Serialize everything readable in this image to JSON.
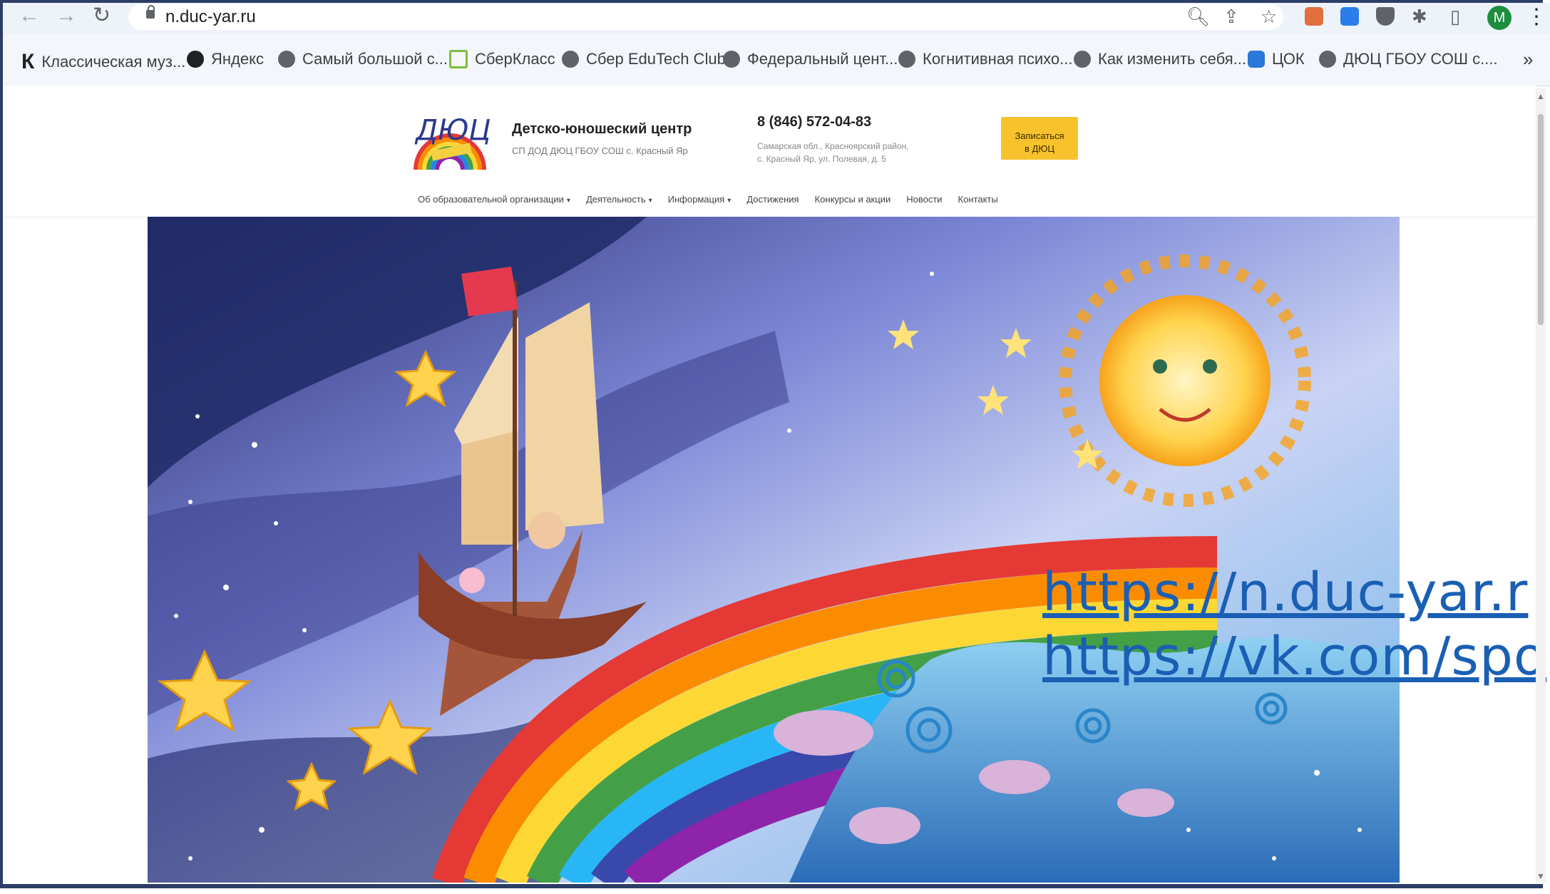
{
  "browser": {
    "url": "n.duc-yar.ru",
    "avatar_letter": "M",
    "bookmarks": [
      {
        "label": "Классическая муз...",
        "icon": "k-icon"
      },
      {
        "label": "Яндекс",
        "icon": "yandex-icon"
      },
      {
        "label": "Самый большой с...",
        "icon": "globe-icon"
      },
      {
        "label": "СберКласс",
        "icon": "sber-icon"
      },
      {
        "label": "Сбер EduTech Club",
        "icon": "globe-icon"
      },
      {
        "label": "Федеральный цент...",
        "icon": "globe-icon"
      },
      {
        "label": "Когнитивная психо...",
        "icon": "globe-icon"
      },
      {
        "label": "Как изменить себя...",
        "icon": "globe-icon"
      },
      {
        "label": "ЦОК",
        "icon": "cok-icon"
      },
      {
        "label": "ДЮЦ ГБОУ СОШ с....",
        "icon": "globe-icon"
      }
    ],
    "more_bookmarks": "»"
  },
  "site": {
    "org_name": "Детско-юношеский центр",
    "org_sub": "СП ДОД ДЮЦ ГБОУ СОШ с. Красный Яр",
    "phone": "8 (846) 572-04-83",
    "address_line1": "Самарская обл., Красноярский район,",
    "address_line2": "с. Красный Яр, ул. Полевая, д. 5",
    "signup_line1": "Записаться",
    "signup_line2": "в ДЮЦ",
    "nav": [
      {
        "label": "Об образовательной организации",
        "has_dropdown": true
      },
      {
        "label": "Деятельность",
        "has_dropdown": true
      },
      {
        "label": "Информация",
        "has_dropdown": true
      },
      {
        "label": "Достижения",
        "has_dropdown": false
      },
      {
        "label": "Конкурсы и акции",
        "has_dropdown": false
      },
      {
        "label": "Новости",
        "has_dropdown": false
      },
      {
        "label": "Контакты",
        "has_dropdown": false
      }
    ]
  },
  "overlay_links": {
    "link1": "https://n.duc-yar.r",
    "link2": "https://vk.com/spo"
  },
  "colors": {
    "accent": "#f7c22c",
    "link": "#1a5fb4",
    "frame": "#2c3e66"
  }
}
